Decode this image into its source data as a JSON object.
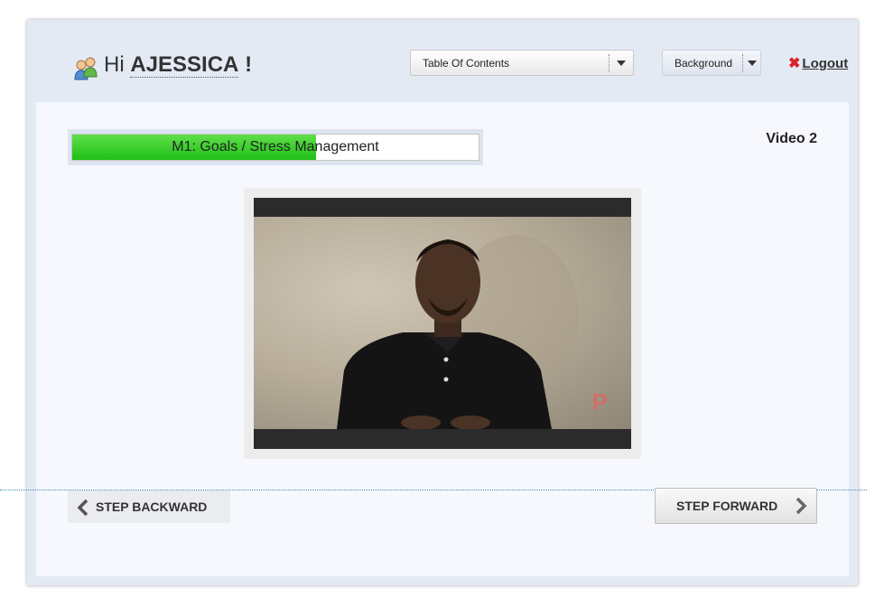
{
  "header": {
    "greeting_prefix": "Hi",
    "user_name": "AJESSICA",
    "greeting_suffix": "!",
    "toc_label": "Table Of Contents",
    "background_label": "Background",
    "logout_label": "Logout"
  },
  "main": {
    "module_label": "M1: Goals / Stress Management",
    "progress_fraction": 0.6,
    "video_title": "Video 2",
    "video_watermark": "P"
  },
  "nav": {
    "back_label": "STEP BACKWARD",
    "forward_label": "STEP FORWARD"
  },
  "colors": {
    "progress_fill": "#2ecc20",
    "logout_x": "#d9232c",
    "panel_bg": "#f6f8fd",
    "frame_bg": "#e4eaf4"
  },
  "icons": [
    "users-icon",
    "chevron-down-icon",
    "close-icon",
    "chevron-left-icon",
    "chevron-right-icon"
  ]
}
